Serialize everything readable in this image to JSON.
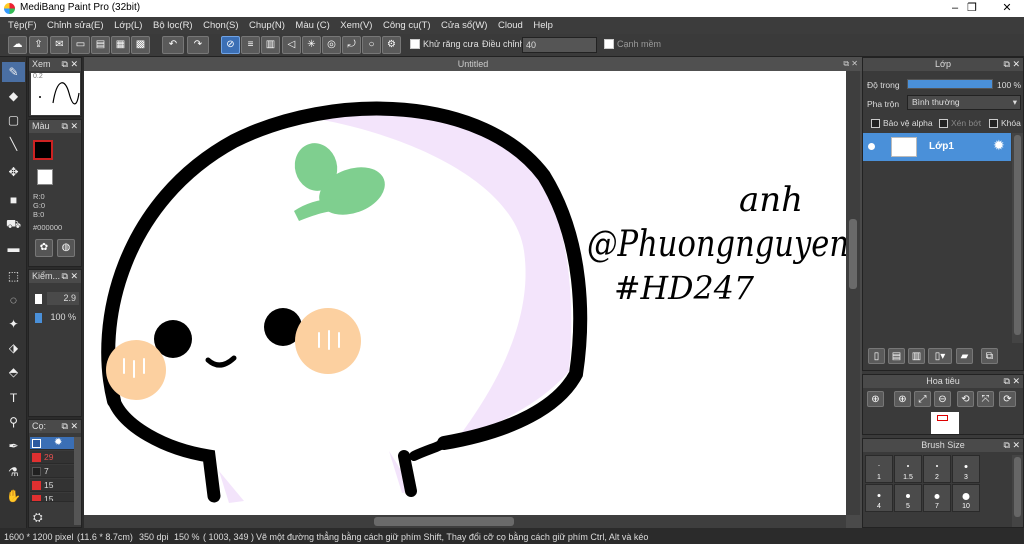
{
  "window": {
    "title": "MediBang Paint Pro (32bit)",
    "minimize": "–",
    "maximize": "❐",
    "close": "✕"
  },
  "menu": [
    "Tệp(F)",
    "Chỉnh sửa(E)",
    "Lớp(L)",
    "Bộ lọc(R)",
    "Chọn(S)",
    "Chụp(N)",
    "Màu (C)",
    "Xem(V)",
    "Công cụ(T)",
    "Cửa sổ(W)",
    "Cloud",
    "Help"
  ],
  "toolbar": {
    "antialias_label": "Khử răng cưa",
    "correction_label": "Điều chỉnh",
    "correction_value": "40",
    "sharp_edge_label": "Cạnh mềm"
  },
  "canvas": {
    "tab_title": "Untitled",
    "sign_name": "anh",
    "sign_handle": "@Phuongnguyen",
    "sign_tag": "#HD247"
  },
  "navigator_small": {
    "title": "Xem",
    "value": "0.2"
  },
  "color_panel": {
    "title": "Màu",
    "r": "R:0",
    "g": "G:0",
    "b": "B:0",
    "hex": "#000000",
    "primary": "#000000",
    "secondary": "#ffffff"
  },
  "brush_panel": {
    "title": "Kiểm...",
    "size": "2.9",
    "opacity": "100 %"
  },
  "color_list": {
    "title": "Cọ:",
    "items": [
      {
        "label": "",
        "color": "#2c5aa0"
      },
      {
        "label": "29",
        "color": "#e03030"
      },
      {
        "label": "7",
        "color": "#202020"
      },
      {
        "label": "15",
        "color": "#e03030"
      },
      {
        "label": "15",
        "color": "#e03030"
      }
    ]
  },
  "layer_panel": {
    "title": "Lớp",
    "opacity_label": "Độ trong",
    "opacity_value": "100 %",
    "opacity_fraction": 1.0,
    "blend_label": "Pha trộn",
    "blend_value": "Bình thường",
    "protect_alpha": "Bảo vệ alpha",
    "clip": "Xén bớt",
    "lock": "Khóa",
    "layer_name": "Lớp1"
  },
  "navigator": {
    "title": "Hoa tiêu"
  },
  "brush_size": {
    "title": "Brush Size",
    "sizes": [
      "1",
      "1.5",
      "2",
      "3",
      "4",
      "5",
      "7",
      "10"
    ]
  },
  "status": {
    "dimensions": "1600 * 1200 pixel",
    "physical": "(11.6 * 8.7cm)",
    "dpi": "350 dpi",
    "zoom": "150 %",
    "coords": "( 1003, 349 )",
    "hint": "Vẽ một đường thẳng bằng cách giữ phím Shift, Thay đổi cỡ cọ bằng cách giữ phím Ctrl, Alt và kéo"
  },
  "colors": {
    "accent": "#4a90d9",
    "layer_selected": "#4a90d9",
    "canvas_bg": "#ffffff",
    "stroke": "#000000",
    "blush": "#fcd0a0",
    "leaf": "#7fcf8f",
    "shade": "#f3e4fb"
  }
}
